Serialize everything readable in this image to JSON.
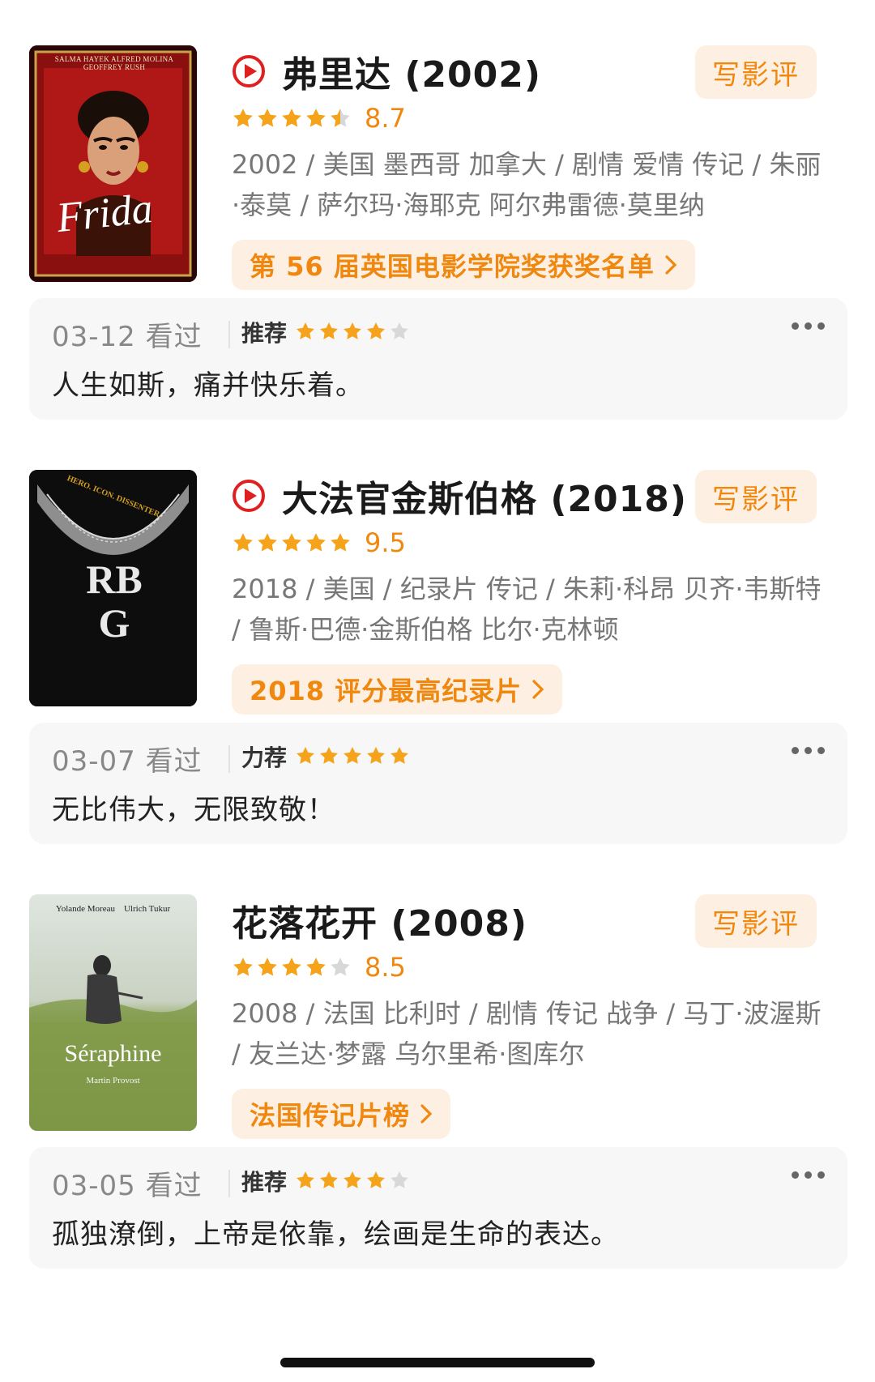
{
  "colors": {
    "accent": "#f0870f",
    "pill_bg": "#fdf0e2",
    "play_red": "#e02020",
    "star_on": "#f5a31a",
    "star_off": "#d8d8d8"
  },
  "movies": [
    {
      "title": "弗里达 (2002)",
      "playable": true,
      "stars": 4.5,
      "score": "8.7",
      "meta": "2002 / 美国 墨西哥 加拿大 / 剧情 爱情 传记 / 朱丽·泰莫 / 萨尔玛·海耶克 阿尔弗雷德·莫里纳",
      "list": "第 56 届英国电影学院奖获奖名单",
      "write_label": "写影评",
      "poster": {
        "top_text": "SALMA HAYEK  ALFRED MOLINA  GEOFFREY RUSH",
        "logo": "Frida"
      },
      "review": {
        "date": "03-12 看过",
        "rec": "推荐",
        "stars": 4,
        "comment": "人生如斯，痛并快乐着。"
      }
    },
    {
      "title": "大法官金斯伯格 (2018)",
      "playable": true,
      "stars": 5,
      "score": "9.5",
      "meta": "2018 / 美国 / 纪录片 传记 / 朱莉·科昂 贝齐·韦斯特 / 鲁斯·巴德·金斯伯格 比尔·克林顿",
      "list": "2018 评分最高纪录片",
      "write_label": "写影评",
      "poster": {
        "top_text": "HERO. ICON. DISSENTER.",
        "logo": "RBG"
      },
      "review": {
        "date": "03-07 看过",
        "rec": "力荐",
        "stars": 5,
        "comment": "无比伟大，无限致敬！"
      }
    },
    {
      "title": "花落花开 (2008)",
      "playable": false,
      "stars": 4,
      "score": "8.5",
      "meta": "2008 / 法国 比利时 / 剧情 传记 战争 / 马丁·波渥斯 / 友兰达·梦露 乌尔里希·图库尔",
      "list": "法国传记片榜",
      "write_label": "写影评",
      "poster": {
        "top_text": "Yolande Moreau    Ulrich Tukur",
        "logo": "Séraphine",
        "director": "Martin Provost"
      },
      "review": {
        "date": "03-05 看过",
        "rec": "推荐",
        "stars": 4,
        "comment": "孤独潦倒，上帝是依靠，绘画是生命的表达。"
      }
    }
  ]
}
